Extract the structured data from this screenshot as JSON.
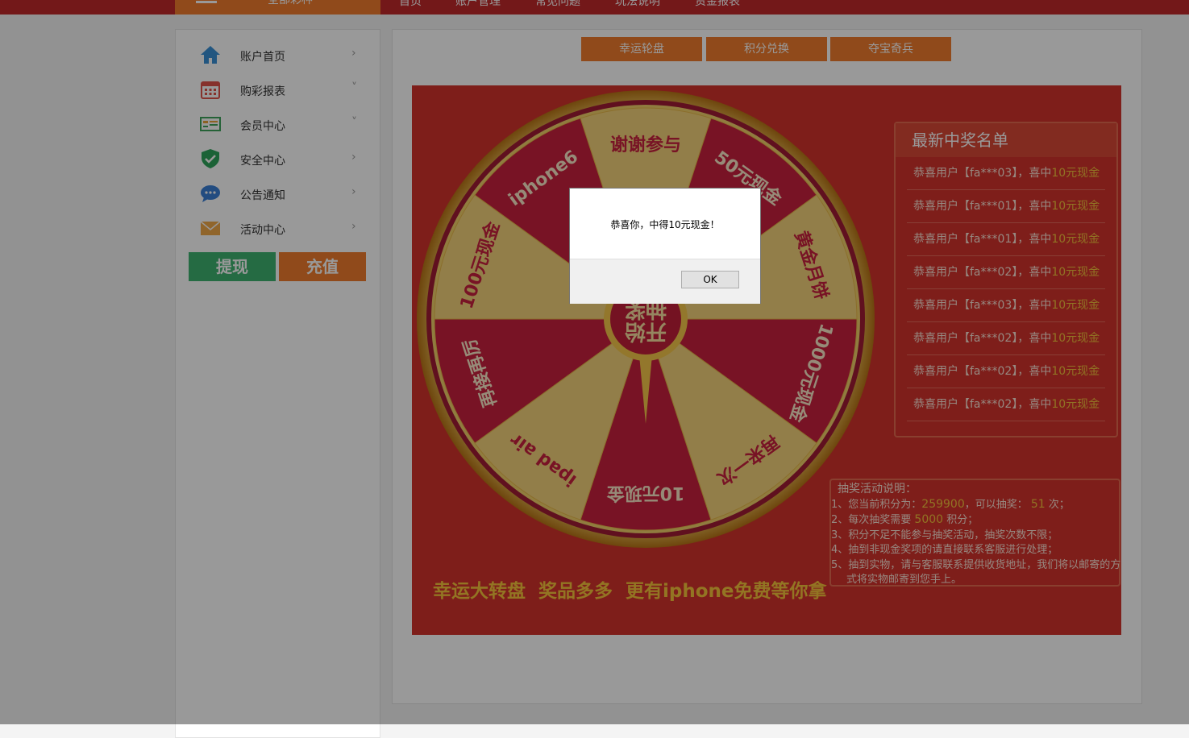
{
  "topnav": {
    "all_games": "全部彩种",
    "items": [
      "首页",
      "账户管理",
      "常见问题",
      "玩法说明",
      "资金报表"
    ]
  },
  "sidebar": {
    "items": [
      {
        "label": "账户首页",
        "arrow": "›",
        "icon": "home-icon"
      },
      {
        "label": "购彩报表",
        "arrow": "˅",
        "icon": "calendar-icon"
      },
      {
        "label": "会员中心",
        "arrow": "˅",
        "icon": "member-card-icon"
      },
      {
        "label": "安全中心",
        "arrow": "›",
        "icon": "shield-check-icon"
      },
      {
        "label": "公告通知",
        "arrow": "›",
        "icon": "chat-bubble-icon"
      },
      {
        "label": "活动中心",
        "arrow": "›",
        "icon": "envelope-icon"
      }
    ],
    "withdraw_label": "提现",
    "deposit_label": "充值"
  },
  "tabs": [
    "幸运轮盘",
    "积分兑换",
    "夺宝奇兵"
  ],
  "wheel": {
    "center_label": "开始抽奖",
    "segments": [
      "谢谢参与",
      "50元现金",
      "黄金月饼",
      "1000元现金",
      "再来一次",
      "10元现金",
      "ipad air",
      "再接再厉",
      "100元现金",
      "iphone6"
    ]
  },
  "winners": {
    "title": "最新中奖名单",
    "rows": [
      {
        "text": "恭喜用户【fa***03】，喜中",
        "prize": "10元现金"
      },
      {
        "text": "恭喜用户【fa***01】，喜中",
        "prize": "10元现金"
      },
      {
        "text": "恭喜用户【fa***01】，喜中",
        "prize": "10元现金"
      },
      {
        "text": "恭喜用户【fa***02】，喜中",
        "prize": "10元现金"
      },
      {
        "text": "恭喜用户【fa***03】，喜中",
        "prize": "10元现金"
      },
      {
        "text": "恭喜用户【fa***02】，喜中",
        "prize": "10元现金"
      },
      {
        "text": "恭喜用户【fa***02】，喜中",
        "prize": "10元现金"
      },
      {
        "text": "恭喜用户【fa***02】，喜中",
        "prize": "10元现金"
      }
    ]
  },
  "rules": {
    "title": "抽奖活动说明：",
    "line1_a": "1、您当前积分为：",
    "points": "259900",
    "line1_b": "，可以抽奖：",
    "draws": "51",
    "line1_c": "次；",
    "line2_a": "2、每次抽奖需要",
    "cost": "5000",
    "line2_b": "积分；",
    "line3": "3、积分不足不能参与抽奖活动，抽奖次数不限；",
    "line4": "4、抽到非现金奖项的请直接联系客服进行处理；",
    "line5": "5、抽到实物，请与客服联系提供收货地址，我们将以邮寄的方",
    "line5_cont": "式将实物邮寄到您手上。"
  },
  "slogan": [
    "幸运大转盘",
    "奖品多多",
    "更有iphone免费等你拿"
  ],
  "dialog": {
    "message": "恭喜你，中得10元现金！",
    "ok_label": "OK"
  }
}
